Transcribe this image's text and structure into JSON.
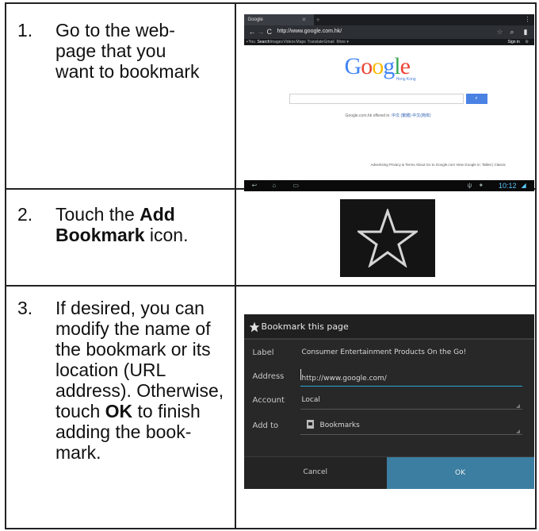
{
  "steps": [
    {
      "number": "1.",
      "lines": [
        "Go to the web-",
        "page that you",
        "want to bookmark"
      ]
    },
    {
      "number": "2.",
      "text_before": "Touch the ",
      "bold": "Add Bookmark",
      "text_after": " icon."
    },
    {
      "number": "3.",
      "text_before": "If desired, you can modify the name of the bookmark or its location (URL address). Otherwise, touch ",
      "bold": "OK",
      "text_after": " to finish adding the book-mark."
    }
  ],
  "browser": {
    "tab_label": "Google",
    "url": "http://www.google.com.hk/",
    "links": [
      "+You",
      "Search",
      "Images",
      "Videos",
      "Maps",
      "Translate",
      "Gmail",
      "More ▾"
    ],
    "sign_in": "Sign in",
    "logo": "Google",
    "logo_sub": "Hong Kong",
    "offered_prefix": "Google.com.hk offered in:",
    "offered_langs": [
      "中文 (繁體)",
      "中文(简体)"
    ],
    "footer": "Advertising   Privacy & Terms   About   Go to Google.com   View Google in: Tablet | Classic",
    "clock": "10:12",
    "colors": {
      "blue": "#4285f4",
      "red": "#ea4335",
      "yellow": "#fbbc05",
      "green": "#34a853"
    }
  },
  "dialog": {
    "title": "Bookmark this page",
    "fields": [
      {
        "label": "Label",
        "value": "Consumer Entertainment Products On the Go!"
      },
      {
        "label": "Address",
        "value": "http://www.google.com/"
      },
      {
        "label": "Account",
        "value": "Local"
      },
      {
        "label": "Add to",
        "value": "Bookmarks"
      }
    ],
    "cancel_label": "Cancel",
    "ok_label": "OK",
    "ok_color": "#3b7ea1"
  }
}
